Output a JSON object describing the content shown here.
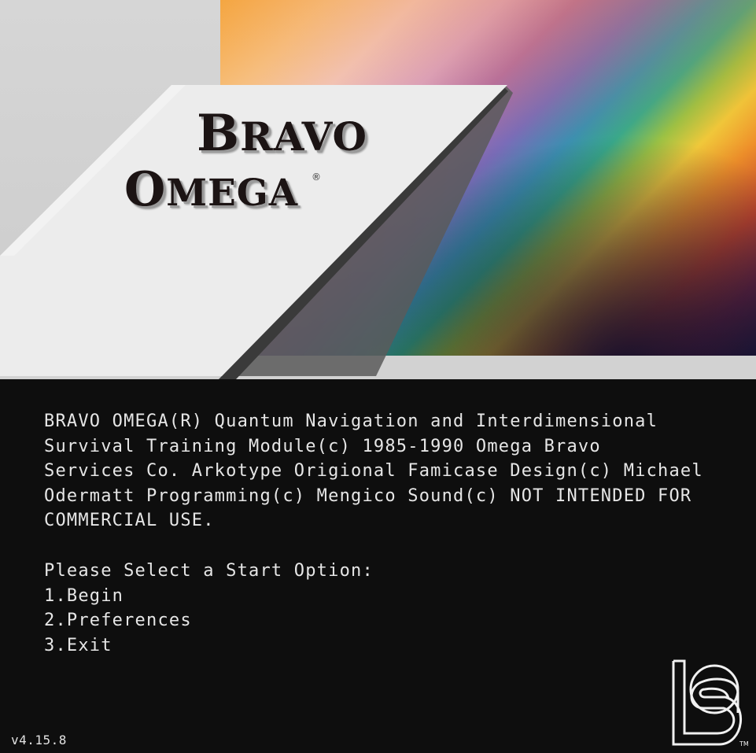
{
  "banner": {
    "logo_line1_first": "B",
    "logo_line1_rest": "RAVO",
    "logo_line2_first": "O",
    "logo_line2_rest": "MEGA",
    "registered_mark": "®"
  },
  "console": {
    "intro_lines": [
      "BRAVO OMEGA(R) Quantum Navigation and Interdimensional",
      "Survival Training Module(c) 1985-1990 Omega Bravo",
      "Services Co. Arkotype Origional Famicase Design(c) Michael",
      "Odermatt Programming(c) Mengico Sound(c) NOT INTENDED FOR",
      "COMMERCIAL USE."
    ],
    "prompt": "Please Select a Start Option:",
    "options": [
      "1.Begin",
      "2.Preferences",
      "3.Exit"
    ]
  },
  "version": "v4.15.8",
  "corner_logo": {
    "tm": "TM"
  },
  "colors": {
    "background": "#0e0e0e",
    "text": "#e6e6e6",
    "banner_grey": "#d2d2d2",
    "panel_white": "#ececec"
  }
}
